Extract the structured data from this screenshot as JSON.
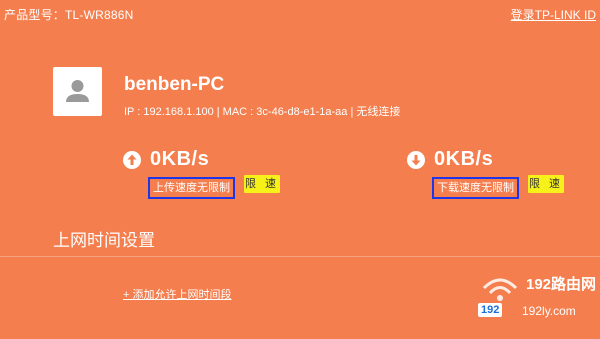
{
  "header": {
    "product_model": "产品型号：TL-WR886N",
    "login_link": "登录TP-LINK ID"
  },
  "device": {
    "name": "benben-PC",
    "info": "IP : 192.168.1.100 | MAC : 3c-46-d8-e1-1a-aa | 无线连接",
    "avatar_icon": "user-icon"
  },
  "upload": {
    "arrow_icon": "arrow-up-circle-icon",
    "speed": "0KB/s",
    "status": "上传速度无限制",
    "limit_label": "限 速"
  },
  "download": {
    "arrow_icon": "arrow-down-circle-icon",
    "speed": "0KB/s",
    "status": "下载速度无限制",
    "limit_label": "限 速"
  },
  "time_settings": {
    "title": "上网时间设置",
    "add_link": "+ 添加允许上网时间段"
  },
  "watermark": {
    "brand": "192路由网",
    "number": "192",
    "domain": "192ly.com"
  },
  "colors": {
    "background": "#F47E4E",
    "highlight_border": "#1F35E8",
    "limit_button": "#F6F219",
    "text": "#FFFFFF"
  }
}
